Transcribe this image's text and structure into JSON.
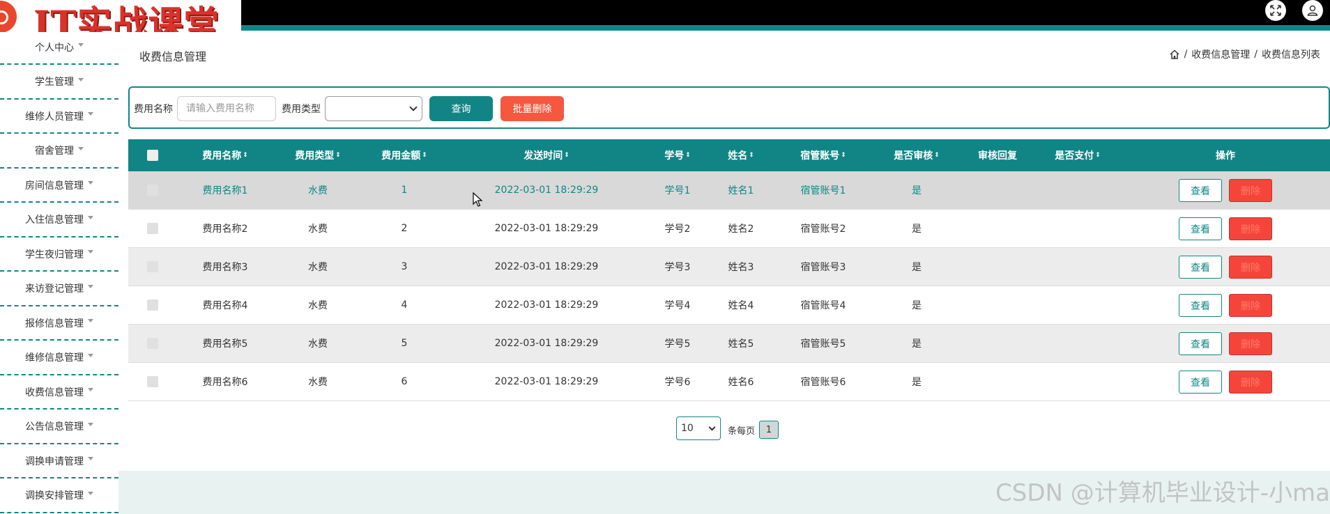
{
  "app": {
    "logo_text": "IT实战课堂"
  },
  "header": {
    "icons": [
      "fullscreen-icon",
      "user-icon"
    ]
  },
  "sidebar": {
    "items": [
      {
        "label": "个人中心"
      },
      {
        "label": "学生管理"
      },
      {
        "label": "维修人员管理"
      },
      {
        "label": "宿舍管理"
      },
      {
        "label": "房间信息管理"
      },
      {
        "label": "入住信息管理"
      },
      {
        "label": "学生夜归管理"
      },
      {
        "label": "来访登记管理"
      },
      {
        "label": "报修信息管理"
      },
      {
        "label": "维修信息管理"
      },
      {
        "label": "收费信息管理"
      },
      {
        "label": "公告信息管理"
      },
      {
        "label": "调换申请管理"
      },
      {
        "label": "调换安排管理"
      }
    ]
  },
  "page": {
    "title": "收费信息管理",
    "breadcrumb": [
      "收费信息管理",
      "收费信息列表"
    ],
    "breadcrumb_sep": "/"
  },
  "search": {
    "name_label": "费用名称",
    "name_placeholder": "请输入费用名称",
    "type_label": "费用类型",
    "type_value": "",
    "query_button": "查询",
    "batch_delete_button": "批量删除"
  },
  "table": {
    "columns": [
      "费用名称",
      "费用类型",
      "费用金额",
      "发送时间",
      "学号",
      "姓名",
      "宿管账号",
      "是否审核",
      "审核回复",
      "是否支付",
      "操作"
    ],
    "rows": [
      {
        "name": "费用名称1",
        "type": "水费",
        "amount": "1",
        "time": "2022-03-01 18:29:29",
        "student_no": "学号1",
        "student_name": "姓名1",
        "manager": "宿管账号1",
        "reviewed": "是",
        "reply": "",
        "paid": ""
      },
      {
        "name": "费用名称2",
        "type": "水费",
        "amount": "2",
        "time": "2022-03-01 18:29:29",
        "student_no": "学号2",
        "student_name": "姓名2",
        "manager": "宿管账号2",
        "reviewed": "是",
        "reply": "",
        "paid": ""
      },
      {
        "name": "费用名称3",
        "type": "水费",
        "amount": "3",
        "time": "2022-03-01 18:29:29",
        "student_no": "学号3",
        "student_name": "姓名3",
        "manager": "宿管账号3",
        "reviewed": "是",
        "reply": "",
        "paid": ""
      },
      {
        "name": "费用名称4",
        "type": "水费",
        "amount": "4",
        "time": "2022-03-01 18:29:29",
        "student_no": "学号4",
        "student_name": "姓名4",
        "manager": "宿管账号4",
        "reviewed": "是",
        "reply": "",
        "paid": ""
      },
      {
        "name": "费用名称5",
        "type": "水费",
        "amount": "5",
        "time": "2022-03-01 18:29:29",
        "student_no": "学号5",
        "student_name": "姓名5",
        "manager": "宿管账号5",
        "reviewed": "是",
        "reply": "",
        "paid": ""
      },
      {
        "name": "费用名称6",
        "type": "水费",
        "amount": "6",
        "time": "2022-03-01 18:29:29",
        "student_no": "学号6",
        "student_name": "姓名6",
        "manager": "宿管账号6",
        "reviewed": "是",
        "reply": "",
        "paid": ""
      }
    ],
    "view_label": "查看",
    "delete_label": "删除"
  },
  "pagination": {
    "page_size": "10",
    "unit_label": "条每页",
    "current_page": "1"
  },
  "watermark": "CSDN @计算机毕业设计-小ma",
  "colors": {
    "primary": "#118585",
    "danger": "#f5573f",
    "logo": "#d9322a"
  }
}
